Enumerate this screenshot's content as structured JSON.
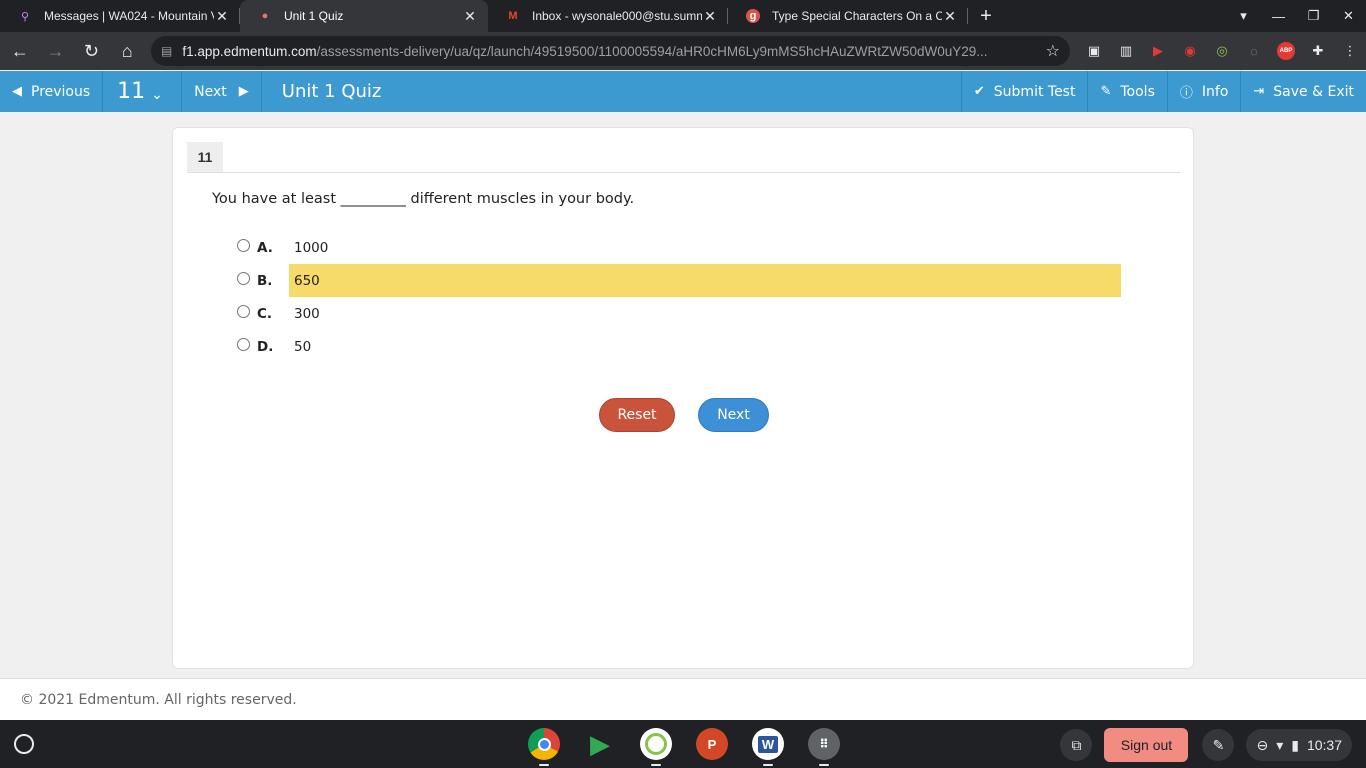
{
  "browser": {
    "tabs": [
      {
        "title": "Messages | WA024 - Mountain V",
        "favicon": "pin-icon",
        "active": false
      },
      {
        "title": "Unit 1 Quiz",
        "favicon": "edmentum-icon",
        "active": true
      },
      {
        "title": "Inbox - wysonale000@stu.sumn",
        "favicon": "gmail-icon",
        "active": false
      },
      {
        "title": "Type Special Characters On a Ch",
        "favicon": "g-icon",
        "active": false
      }
    ],
    "url_domain": "f1.app.edmentum.com",
    "url_path": "/assessments-delivery/ua/qz/launch/49519500/1100005594/aHR0cHM6Ly9mMS5hcHAuZWRtZW50dW0uY29..."
  },
  "header": {
    "previous_label": "Previous",
    "question_number": "11",
    "next_label": "Next",
    "title": "Unit 1 Quiz",
    "submit_label": "Submit Test",
    "tools_label": "Tools",
    "info_label": "Info",
    "save_exit_label": "Save & Exit"
  },
  "question": {
    "number": "11",
    "prompt": "You have at least _________ different muscles in your body.",
    "options": [
      {
        "letter": "A.",
        "value": "1000",
        "highlighted": false
      },
      {
        "letter": "B.",
        "value": "650",
        "highlighted": true
      },
      {
        "letter": "C.",
        "value": "300",
        "highlighted": false
      },
      {
        "letter": "D.",
        "value": "50",
        "highlighted": false
      }
    ],
    "reset_label": "Reset",
    "next_label": "Next"
  },
  "footer": {
    "copyright": "© 2021 Edmentum. All rights reserved."
  },
  "shelf": {
    "signout_label": "Sign out",
    "time": "10:37"
  },
  "colors": {
    "header_blue": "#3c9ad1",
    "highlight_yellow": "#f6db6a",
    "reset_red": "#c9533b",
    "next_blue": "#3d8fd6"
  }
}
